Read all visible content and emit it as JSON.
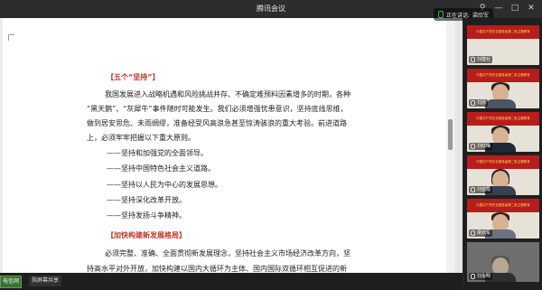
{
  "window": {
    "title": "腾讯会议",
    "controls": {
      "pin_icon": "pin-icon",
      "minimize_icon": "minimize-icon",
      "maximize_icon": "maximize-icon",
      "close_icon": "close-icon"
    }
  },
  "speaking": {
    "prefix": "正在讲话:",
    "name": "梁欣军"
  },
  "document": {
    "lines": [
      {
        "text": "【五个“坚持”】",
        "kind": "heading"
      },
      {
        "text": "我国发展进入战略机遇和风险挑战并存、不确定难预料因素增多的时期，各种",
        "kind": "body"
      },
      {
        "text": "“黑天鹅”、“灰犀牛”事件随时可能发生。我们必须增强忧患意识，坚持底线思维，",
        "kind": "body"
      },
      {
        "text": "做到居安思危、未雨绸缪，准备经受风高浪急甚至惊涛骇浪的重大考验。前进道路",
        "kind": "body"
      },
      {
        "text": "上，必须牢牢把握以下重大原则。",
        "kind": "body"
      },
      {
        "text": "——坚持和加强党的全面领导。",
        "kind": "body"
      },
      {
        "text": "——坚持中国特色社会主义道路。",
        "kind": "body"
      },
      {
        "text": "——坚持以人民为中心的发展思想。",
        "kind": "body"
      },
      {
        "text": "——坚持深化改革开放。",
        "kind": "body"
      },
      {
        "text": "——坚持发扬斗争精神。",
        "kind": "body"
      },
      {
        "text": "【加快构建新发展格局】",
        "kind": "heading"
      },
      {
        "text": "必须完整、准确、全面贯彻新发展理念，坚持社会主义市场经济改革方向，坚",
        "kind": "body"
      },
      {
        "text": "持高水平对外开放，加快构建以国内大循环为主体、国内国际双循环相互促进的新",
        "kind": "body"
      }
    ]
  },
  "bottom": {
    "network_badge": "电信网",
    "share_label": "指屏幕共享"
  },
  "participants": [
    {
      "name": "刘建社",
      "slide_text": "中国共产党在全国各级第二批主题教育"
    },
    {
      "name": "刘苏",
      "slide_text": "中国共产党在全国各级第二批主题教育"
    },
    {
      "name": "刘红梅",
      "slide_text": "中国共产党在全国各级第二批主题教育"
    },
    {
      "name": "刘亚霞",
      "slide_text": "中国共产党在全国各级第二批主题教育"
    },
    {
      "name": "梁欣军",
      "slide_text": "中国共产党在全国各级第二批主题教育"
    },
    {
      "name": "刘永明",
      "slide_text": ""
    }
  ],
  "colors": {
    "heading": "#c0392b",
    "slide_red": "#b81d1d",
    "slide_text": "#ffd84d",
    "network_green": "#3a6e35"
  }
}
